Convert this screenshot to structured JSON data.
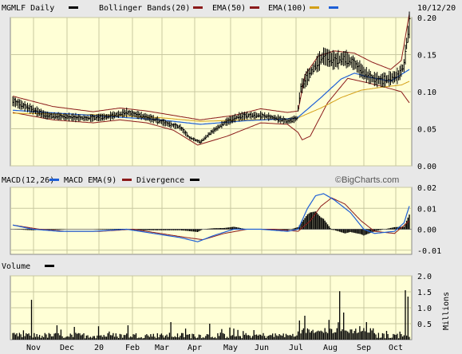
{
  "chart_data": [
    {
      "type": "line",
      "panel": "price",
      "ticker_label": "MGMLF Daily",
      "date_label": "10/12/20",
      "legend": [
        {
          "name": "Bollinger Bands(20)",
          "color": "#8b1a1a"
        },
        {
          "name": "EMA(50)",
          "color": "#8b1a1a"
        },
        {
          "name": "EMA(100)",
          "color": "#d4a017"
        }
      ],
      "legend_extra_swatch_color": "#1e5fd6",
      "ylim": [
        0,
        0.2
      ],
      "y_ticks": [
        "0.00",
        "0.05",
        "0.10",
        "0.15",
        "0.20"
      ],
      "x_ticks": [
        "Nov",
        "Dec",
        "20",
        "Feb",
        "Mar",
        "Apr",
        "May",
        "Jun",
        "Jul",
        "Aug",
        "Sep",
        "Oct"
      ],
      "price_knots": [
        [
          0,
          0.087
        ],
        [
          12,
          0.078
        ],
        [
          25,
          0.068
        ],
        [
          40,
          0.066
        ],
        [
          55,
          0.064
        ],
        [
          70,
          0.066
        ],
        [
          85,
          0.072
        ],
        [
          95,
          0.068
        ],
        [
          105,
          0.063
        ],
        [
          115,
          0.057
        ],
        [
          125,
          0.052
        ],
        [
          132,
          0.038
        ],
        [
          140,
          0.032
        ],
        [
          148,
          0.045
        ],
        [
          158,
          0.058
        ],
        [
          168,
          0.066
        ],
        [
          175,
          0.068
        ],
        [
          185,
          0.068
        ],
        [
          195,
          0.065
        ],
        [
          205,
          0.06
        ],
        [
          212,
          0.064
        ],
        [
          215,
          0.105
        ],
        [
          220,
          0.12
        ],
        [
          226,
          0.135
        ],
        [
          232,
          0.148
        ],
        [
          240,
          0.142
        ],
        [
          248,
          0.145
        ],
        [
          255,
          0.138
        ],
        [
          262,
          0.125
        ],
        [
          268,
          0.118
        ],
        [
          275,
          0.115
        ],
        [
          282,
          0.118
        ],
        [
          288,
          0.122
        ],
        [
          292,
          0.135
        ],
        [
          294,
          0.165
        ],
        [
          296,
          0.19
        ]
      ],
      "ema50_knots": [
        [
          0,
          0.075
        ],
        [
          60,
          0.068
        ],
        [
          110,
          0.062
        ],
        [
          140,
          0.056
        ],
        [
          175,
          0.061
        ],
        [
          212,
          0.064
        ],
        [
          230,
          0.092
        ],
        [
          245,
          0.117
        ],
        [
          255,
          0.125
        ],
        [
          265,
          0.12
        ],
        [
          282,
          0.114
        ],
        [
          296,
          0.13
        ]
      ],
      "ema100_knots": [
        [
          0,
          0.071
        ],
        [
          60,
          0.069
        ],
        [
          110,
          0.065
        ],
        [
          140,
          0.06
        ],
        [
          175,
          0.062
        ],
        [
          212,
          0.064
        ],
        [
          230,
          0.078
        ],
        [
          245,
          0.092
        ],
        [
          260,
          0.102
        ],
        [
          275,
          0.106
        ],
        [
          290,
          0.109
        ],
        [
          296,
          0.114
        ]
      ],
      "upper_band_knots": [
        [
          0,
          0.094
        ],
        [
          30,
          0.08
        ],
        [
          60,
          0.073
        ],
        [
          80,
          0.078
        ],
        [
          100,
          0.074
        ],
        [
          120,
          0.068
        ],
        [
          140,
          0.062
        ],
        [
          165,
          0.068
        ],
        [
          185,
          0.077
        ],
        [
          205,
          0.072
        ],
        [
          213,
          0.074
        ],
        [
          218,
          0.122
        ],
        [
          228,
          0.148
        ],
        [
          240,
          0.155
        ],
        [
          255,
          0.152
        ],
        [
          268,
          0.14
        ],
        [
          282,
          0.13
        ],
        [
          290,
          0.142
        ],
        [
          296,
          0.205
        ]
      ],
      "lower_band_knots": [
        [
          0,
          0.072
        ],
        [
          30,
          0.062
        ],
        [
          60,
          0.058
        ],
        [
          80,
          0.062
        ],
        [
          100,
          0.058
        ],
        [
          120,
          0.048
        ],
        [
          138,
          0.028
        ],
        [
          160,
          0.04
        ],
        [
          185,
          0.058
        ],
        [
          205,
          0.056
        ],
        [
          213,
          0.045
        ],
        [
          216,
          0.035
        ],
        [
          222,
          0.04
        ],
        [
          235,
          0.085
        ],
        [
          250,
          0.118
        ],
        [
          265,
          0.112
        ],
        [
          280,
          0.105
        ],
        [
          290,
          0.1
        ],
        [
          296,
          0.085
        ]
      ]
    },
    {
      "type": "line",
      "panel": "macd",
      "legend": [
        {
          "name": "MACD(12,26)",
          "color": "#1e5fd6"
        },
        {
          "name": "MACD EMA(9)",
          "color": "#8b1a1a"
        },
        {
          "name": "Divergence",
          "color": "#000000"
        }
      ],
      "ylim": [
        -0.012,
        0.02
      ],
      "y_ticks": [
        "0.02",
        "0.01",
        "0.00",
        "-0.01"
      ],
      "macd_knots": [
        [
          0,
          0.002
        ],
        [
          15,
          0.0
        ],
        [
          35,
          -0.001
        ],
        [
          60,
          -0.001
        ],
        [
          85,
          0.0
        ],
        [
          105,
          -0.002
        ],
        [
          125,
          -0.004
        ],
        [
          138,
          -0.006
        ],
        [
          150,
          -0.003
        ],
        [
          165,
          0.0
        ],
        [
          185,
          0.0
        ],
        [
          205,
          -0.001
        ],
        [
          213,
          0.0
        ],
        [
          220,
          0.01
        ],
        [
          226,
          0.016
        ],
        [
          232,
          0.017
        ],
        [
          240,
          0.014
        ],
        [
          252,
          0.008
        ],
        [
          262,
          0.0
        ],
        [
          270,
          -0.002
        ],
        [
          285,
          -0.001
        ],
        [
          292,
          0.003
        ],
        [
          296,
          0.011
        ]
      ],
      "signal_knots": [
        [
          0,
          0.002
        ],
        [
          20,
          0.0
        ],
        [
          40,
          -0.001
        ],
        [
          65,
          -0.001
        ],
        [
          90,
          0.0
        ],
        [
          110,
          -0.002
        ],
        [
          130,
          -0.004
        ],
        [
          142,
          -0.005
        ],
        [
          158,
          -0.002
        ],
        [
          175,
          0.0
        ],
        [
          195,
          0.0
        ],
        [
          213,
          -0.001
        ],
        [
          222,
          0.004
        ],
        [
          230,
          0.011
        ],
        [
          238,
          0.015
        ],
        [
          248,
          0.012
        ],
        [
          260,
          0.004
        ],
        [
          270,
          -0.001
        ],
        [
          285,
          -0.002
        ],
        [
          296,
          0.004
        ]
      ]
    },
    {
      "type": "bar",
      "panel": "volume",
      "legend": [
        {
          "name": "Volume",
          "color": "#000000"
        }
      ],
      "ylim": [
        0,
        2.0
      ],
      "y_ticks": [
        "2.0",
        "1.5",
        "1.0",
        "0.5"
      ],
      "ylabel": "Millions",
      "watermark": "©BigCharts.com",
      "spikes": [
        [
          14,
          1.25
        ],
        [
          33,
          0.45
        ],
        [
          46,
          0.4
        ],
        [
          64,
          0.42
        ],
        [
          86,
          0.45
        ],
        [
          118,
          0.55
        ],
        [
          147,
          0.5
        ],
        [
          162,
          0.38
        ],
        [
          180,
          0.3
        ],
        [
          214,
          0.6
        ],
        [
          218,
          0.75
        ],
        [
          236,
          0.62
        ],
        [
          244,
          1.52
        ],
        [
          247,
          0.85
        ],
        [
          264,
          0.55
        ],
        [
          293,
          1.55
        ],
        [
          295,
          1.35
        ]
      ]
    }
  ]
}
